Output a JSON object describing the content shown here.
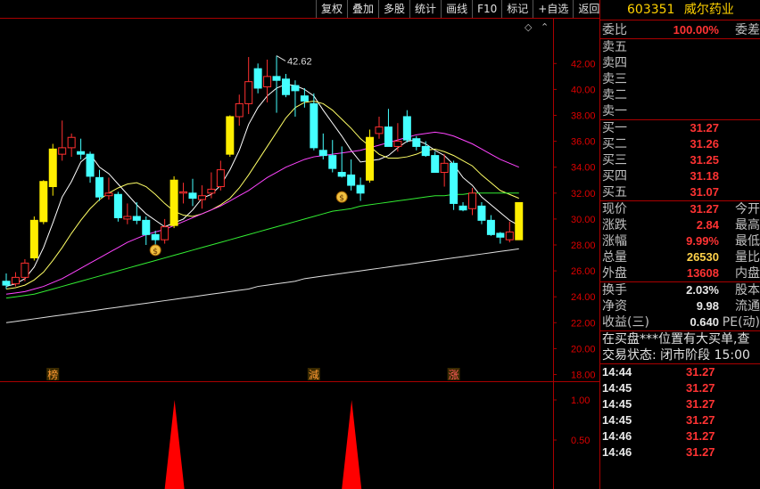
{
  "toolbar": {
    "buttons": [
      "复权",
      "叠加",
      "多股",
      "统计",
      "画线",
      "F10",
      "标记",
      "+自选",
      "返回"
    ]
  },
  "stock": {
    "code": "603351",
    "name": "威尔药业"
  },
  "order_book": {
    "weibi_label": "委比",
    "weibi_value": "100.00%",
    "weicha_label": "委差",
    "asks": [
      {
        "label": "卖五"
      },
      {
        "label": "卖四"
      },
      {
        "label": "卖三"
      },
      {
        "label": "卖二"
      },
      {
        "label": "卖一"
      }
    ],
    "bids": [
      {
        "label": "买一",
        "price": "31.27"
      },
      {
        "label": "买二",
        "price": "31.26"
      },
      {
        "label": "买三",
        "price": "31.25"
      },
      {
        "label": "买四",
        "price": "31.18"
      },
      {
        "label": "买五",
        "price": "31.07"
      }
    ]
  },
  "quote": [
    {
      "label": "现价",
      "value": "31.27",
      "label2": "今开",
      "color": "#ff3333"
    },
    {
      "label": "涨跌",
      "value": "2.84",
      "label2": "最高",
      "color": "#ff3333"
    },
    {
      "label": "涨幅",
      "value": "9.99%",
      "label2": "最低",
      "color": "#ff3333"
    },
    {
      "label": "总量",
      "value": "26530",
      "label2": "量比",
      "color": "#ffd24a"
    },
    {
      "label": "外盘",
      "value": "13608",
      "label2": "内盘",
      "color": "#ff3333"
    }
  ],
  "fundamentals": [
    {
      "label": "换手",
      "value": "2.03%",
      "label2": "股本"
    },
    {
      "label": "净资",
      "value": "9.98",
      "label2": "流通"
    },
    {
      "label": "收益(三)",
      "value": "0.640",
      "label2": "PE(动)"
    }
  ],
  "messages": [
    "在买盘***位置有大买单,查",
    "交易状态: 闭市阶段 15:00"
  ],
  "ticks": [
    {
      "time": "14:44",
      "price": "31.27"
    },
    {
      "time": "14:45",
      "price": "31.27"
    },
    {
      "time": "14:45",
      "price": "31.27"
    },
    {
      "time": "14:45",
      "price": "31.27"
    },
    {
      "time": "14:46",
      "price": "31.27"
    },
    {
      "time": "14:46",
      "price": "31.27"
    }
  ],
  "chart_data": {
    "type": "candlestick",
    "y_ticks": [
      18,
      20,
      22,
      24,
      26,
      28,
      30,
      32,
      34,
      36,
      38,
      40,
      42
    ],
    "y_tick_labels": [
      "18.00",
      "20.00",
      "22.00",
      "24.00",
      "26.00",
      "28.00",
      "30.00",
      "32.00",
      "34.00",
      "36.00",
      "38.00",
      "40.00",
      "42.00"
    ],
    "high_marker": "42.62",
    "candles": [
      {
        "o": 25.2,
        "h": 25.8,
        "l": 24.6,
        "c": 24.9
      },
      {
        "o": 25.0,
        "h": 25.9,
        "l": 24.8,
        "c": 25.5
      },
      {
        "o": 25.5,
        "h": 26.9,
        "l": 25.2,
        "c": 26.6
      },
      {
        "o": 27.0,
        "h": 30.2,
        "l": 26.8,
        "c": 29.9
      },
      {
        "o": 29.8,
        "h": 33.0,
        "l": 29.6,
        "c": 32.9
      },
      {
        "o": 32.5,
        "h": 35.8,
        "l": 31.8,
        "c": 35.4
      },
      {
        "o": 35.0,
        "h": 37.6,
        "l": 34.5,
        "c": 35.5
      },
      {
        "o": 35.5,
        "h": 36.6,
        "l": 34.8,
        "c": 36.3
      },
      {
        "o": 35.2,
        "h": 36.2,
        "l": 34.6,
        "c": 35.0
      },
      {
        "o": 35.0,
        "h": 35.2,
        "l": 32.8,
        "c": 33.3
      },
      {
        "o": 33.2,
        "h": 33.8,
        "l": 31.4,
        "c": 31.7
      },
      {
        "o": 31.8,
        "h": 33.2,
        "l": 31.5,
        "c": 32.0
      },
      {
        "o": 31.9,
        "h": 32.1,
        "l": 29.8,
        "c": 30.1
      },
      {
        "o": 30.0,
        "h": 31.2,
        "l": 29.6,
        "c": 30.2
      },
      {
        "o": 30.2,
        "h": 31.3,
        "l": 29.6,
        "c": 29.9
      },
      {
        "o": 29.9,
        "h": 30.2,
        "l": 28.0,
        "c": 28.8
      },
      {
        "o": 28.8,
        "h": 29.1,
        "l": 28.0,
        "c": 28.4
      },
      {
        "o": 28.4,
        "h": 30.0,
        "l": 28.1,
        "c": 29.4
      },
      {
        "o": 29.5,
        "h": 33.3,
        "l": 29.3,
        "c": 33.0
      },
      {
        "o": 32.0,
        "h": 32.8,
        "l": 31.2,
        "c": 32.1
      },
      {
        "o": 32.0,
        "h": 33.1,
        "l": 31.0,
        "c": 31.6
      },
      {
        "o": 31.5,
        "h": 32.6,
        "l": 30.8,
        "c": 31.8
      },
      {
        "o": 32.0,
        "h": 33.6,
        "l": 31.6,
        "c": 32.3
      },
      {
        "o": 32.5,
        "h": 34.5,
        "l": 32.2,
        "c": 33.8
      },
      {
        "o": 35.0,
        "h": 38.0,
        "l": 34.8,
        "c": 37.9
      },
      {
        "o": 37.9,
        "h": 39.6,
        "l": 37.2,
        "c": 38.9
      },
      {
        "o": 38.9,
        "h": 42.5,
        "l": 38.1,
        "c": 40.6
      },
      {
        "o": 41.6,
        "h": 42.0,
        "l": 39.7,
        "c": 40.1
      },
      {
        "o": 40.2,
        "h": 42.3,
        "l": 39.0,
        "c": 41.0
      },
      {
        "o": 41.0,
        "h": 42.6,
        "l": 38.2,
        "c": 40.7
      },
      {
        "o": 40.8,
        "h": 41.2,
        "l": 39.4,
        "c": 39.6
      },
      {
        "o": 40.3,
        "h": 40.7,
        "l": 37.9,
        "c": 39.9
      },
      {
        "o": 39.5,
        "h": 40.1,
        "l": 38.6,
        "c": 39.1
      },
      {
        "o": 38.9,
        "h": 39.7,
        "l": 35.3,
        "c": 35.5
      },
      {
        "o": 35.3,
        "h": 36.6,
        "l": 34.6,
        "c": 34.9
      },
      {
        "o": 34.9,
        "h": 36.1,
        "l": 33.6,
        "c": 33.9
      },
      {
        "o": 33.6,
        "h": 35.6,
        "l": 33.2,
        "c": 33.3
      },
      {
        "o": 33.4,
        "h": 34.6,
        "l": 32.2,
        "c": 32.6
      },
      {
        "o": 32.6,
        "h": 33.2,
        "l": 31.4,
        "c": 32.0
      },
      {
        "o": 33.0,
        "h": 36.9,
        "l": 32.8,
        "c": 36.3
      },
      {
        "o": 36.6,
        "h": 37.9,
        "l": 36.2,
        "c": 37.1
      },
      {
        "o": 37.1,
        "h": 38.5,
        "l": 35.8,
        "c": 35.6
      },
      {
        "o": 35.6,
        "h": 37.4,
        "l": 35.2,
        "c": 36.0
      },
      {
        "o": 37.9,
        "h": 38.4,
        "l": 35.9,
        "c": 36.1
      },
      {
        "o": 36.2,
        "h": 36.4,
        "l": 35.3,
        "c": 35.6
      },
      {
        "o": 35.6,
        "h": 36.0,
        "l": 34.8,
        "c": 34.9
      },
      {
        "o": 34.9,
        "h": 35.2,
        "l": 33.6,
        "c": 33.6
      },
      {
        "o": 33.6,
        "h": 35.0,
        "l": 32.5,
        "c": 34.3
      },
      {
        "o": 34.3,
        "h": 34.5,
        "l": 30.7,
        "c": 31.2
      },
      {
        "o": 31.0,
        "h": 31.3,
        "l": 30.6,
        "c": 30.7
      },
      {
        "o": 30.8,
        "h": 32.4,
        "l": 30.3,
        "c": 32.0
      },
      {
        "o": 31.0,
        "h": 31.3,
        "l": 29.6,
        "c": 29.9
      },
      {
        "o": 29.9,
        "h": 30.3,
        "l": 28.7,
        "c": 28.8
      },
      {
        "o": 28.9,
        "h": 29.0,
        "l": 28.1,
        "c": 28.6
      },
      {
        "o": 28.4,
        "h": 29.8,
        "l": 28.2,
        "c": 29.0
      },
      {
        "o": 28.4,
        "h": 31.3,
        "l": 28.4,
        "c": 31.27
      }
    ],
    "ma_series": [
      {
        "color": "#ffffff",
        "values": [
          24.8,
          25.0,
          25.4,
          26.3,
          27.8,
          29.7,
          31.7,
          32.9,
          34.4,
          35.0,
          34.0,
          33.5,
          32.7,
          31.9,
          31.1,
          30.4,
          29.9,
          29.4,
          29.7,
          30.0,
          30.7,
          31.6,
          31.9,
          32.6,
          33.8,
          35.3,
          37.3,
          38.6,
          39.5,
          40.1,
          40.4,
          40.3,
          40.0,
          39.5,
          38.4,
          37.4,
          36.4,
          35.3,
          34.4,
          34.5,
          34.6,
          34.9,
          35.5,
          36.0,
          36.1,
          35.8,
          35.3,
          34.9,
          34.2,
          33.2,
          32.6,
          31.7,
          31.1,
          30.5,
          29.9,
          29.5
        ]
      },
      {
        "color": "#ffff66",
        "values": [
          24.6,
          24.7,
          24.9,
          25.3,
          25.9,
          26.8,
          27.8,
          28.9,
          29.9,
          30.8,
          31.5,
          32.0,
          32.4,
          32.7,
          32.8,
          32.5,
          31.9,
          31.2,
          30.6,
          30.3,
          30.2,
          30.4,
          30.7,
          31.1,
          31.6,
          32.4,
          33.4,
          34.5,
          35.6,
          36.7,
          37.8,
          38.6,
          39.0,
          39.1,
          38.9,
          38.4,
          37.7,
          37.0,
          36.2,
          35.6,
          35.0,
          34.7,
          34.7,
          34.8,
          35.0,
          35.3,
          35.4,
          35.2,
          34.9,
          34.5,
          34.1,
          33.4,
          32.8,
          32.2,
          31.9,
          31.6
        ]
      },
      {
        "color": "#ff44ff",
        "values": [
          24.2,
          24.3,
          24.4,
          24.6,
          24.8,
          25.1,
          25.4,
          25.8,
          26.2,
          26.6,
          27.0,
          27.4,
          27.8,
          28.2,
          28.5,
          28.8,
          29.0,
          29.2,
          29.5,
          29.8,
          30.1,
          30.4,
          30.7,
          31.0,
          31.4,
          31.8,
          32.2,
          32.7,
          33.2,
          33.6,
          34.0,
          34.3,
          34.6,
          34.8,
          34.9,
          35.0,
          35.1,
          35.2,
          35.3,
          35.5,
          35.7,
          35.9,
          36.1,
          36.3,
          36.5,
          36.6,
          36.7,
          36.6,
          36.4,
          36.1,
          35.8,
          35.4,
          35.0,
          34.6,
          34.3,
          34.0
        ]
      },
      {
        "color": "#33ee33",
        "values": [
          23.9,
          24.0,
          24.1,
          24.2,
          24.4,
          24.6,
          24.8,
          25.0,
          25.2,
          25.4,
          25.6,
          25.8,
          26.0,
          26.2,
          26.4,
          26.6,
          26.8,
          27.0,
          27.2,
          27.4,
          27.6,
          27.8,
          28.0,
          28.2,
          28.4,
          28.6,
          28.8,
          29.0,
          29.2,
          29.4,
          29.6,
          29.8,
          30.0,
          30.2,
          30.4,
          30.6,
          30.7,
          30.8,
          31.0,
          31.1,
          31.2,
          31.3,
          31.4,
          31.5,
          31.6,
          31.7,
          31.8,
          31.8,
          31.9,
          31.9,
          32.0,
          32.0,
          32.0,
          32.0,
          32.0,
          32.0
        ]
      },
      {
        "color": "#e0e0e0",
        "values": [
          22.0,
          22.1,
          22.2,
          22.3,
          22.4,
          22.5,
          22.6,
          22.7,
          22.8,
          22.9,
          23.0,
          23.1,
          23.2,
          23.3,
          23.4,
          23.5,
          23.6,
          23.7,
          23.8,
          23.9,
          24.0,
          24.1,
          24.2,
          24.3,
          24.4,
          24.5,
          24.6,
          24.8,
          24.9,
          25.0,
          25.1,
          25.2,
          25.4,
          25.5,
          25.6,
          25.7,
          25.8,
          25.9,
          26.0,
          26.1,
          26.2,
          26.3,
          26.4,
          26.5,
          26.6,
          26.7,
          26.8,
          26.9,
          27.0,
          27.1,
          27.2,
          27.3,
          27.4,
          27.5,
          27.6,
          27.7
        ]
      }
    ],
    "money_markers": [
      {
        "index": 16,
        "y": 27.6
      },
      {
        "index": 36,
        "y": 31.7
      }
    ],
    "tags": [
      {
        "index": 5,
        "text": "榜",
        "color": "#ff9a33"
      },
      {
        "index": 33,
        "text": "減",
        "color": "#ff9a33"
      },
      {
        "index": 48,
        "text": "涨",
        "color": "#ff5a5a"
      }
    ],
    "indicator": {
      "y_ticks": [
        0.5,
        1.0
      ],
      "y_tick_labels": [
        "0.50",
        "1.00"
      ],
      "spikes": [
        {
          "index": 17,
          "value": 1.0
        },
        {
          "index": 36,
          "value": 1.0
        }
      ]
    }
  }
}
